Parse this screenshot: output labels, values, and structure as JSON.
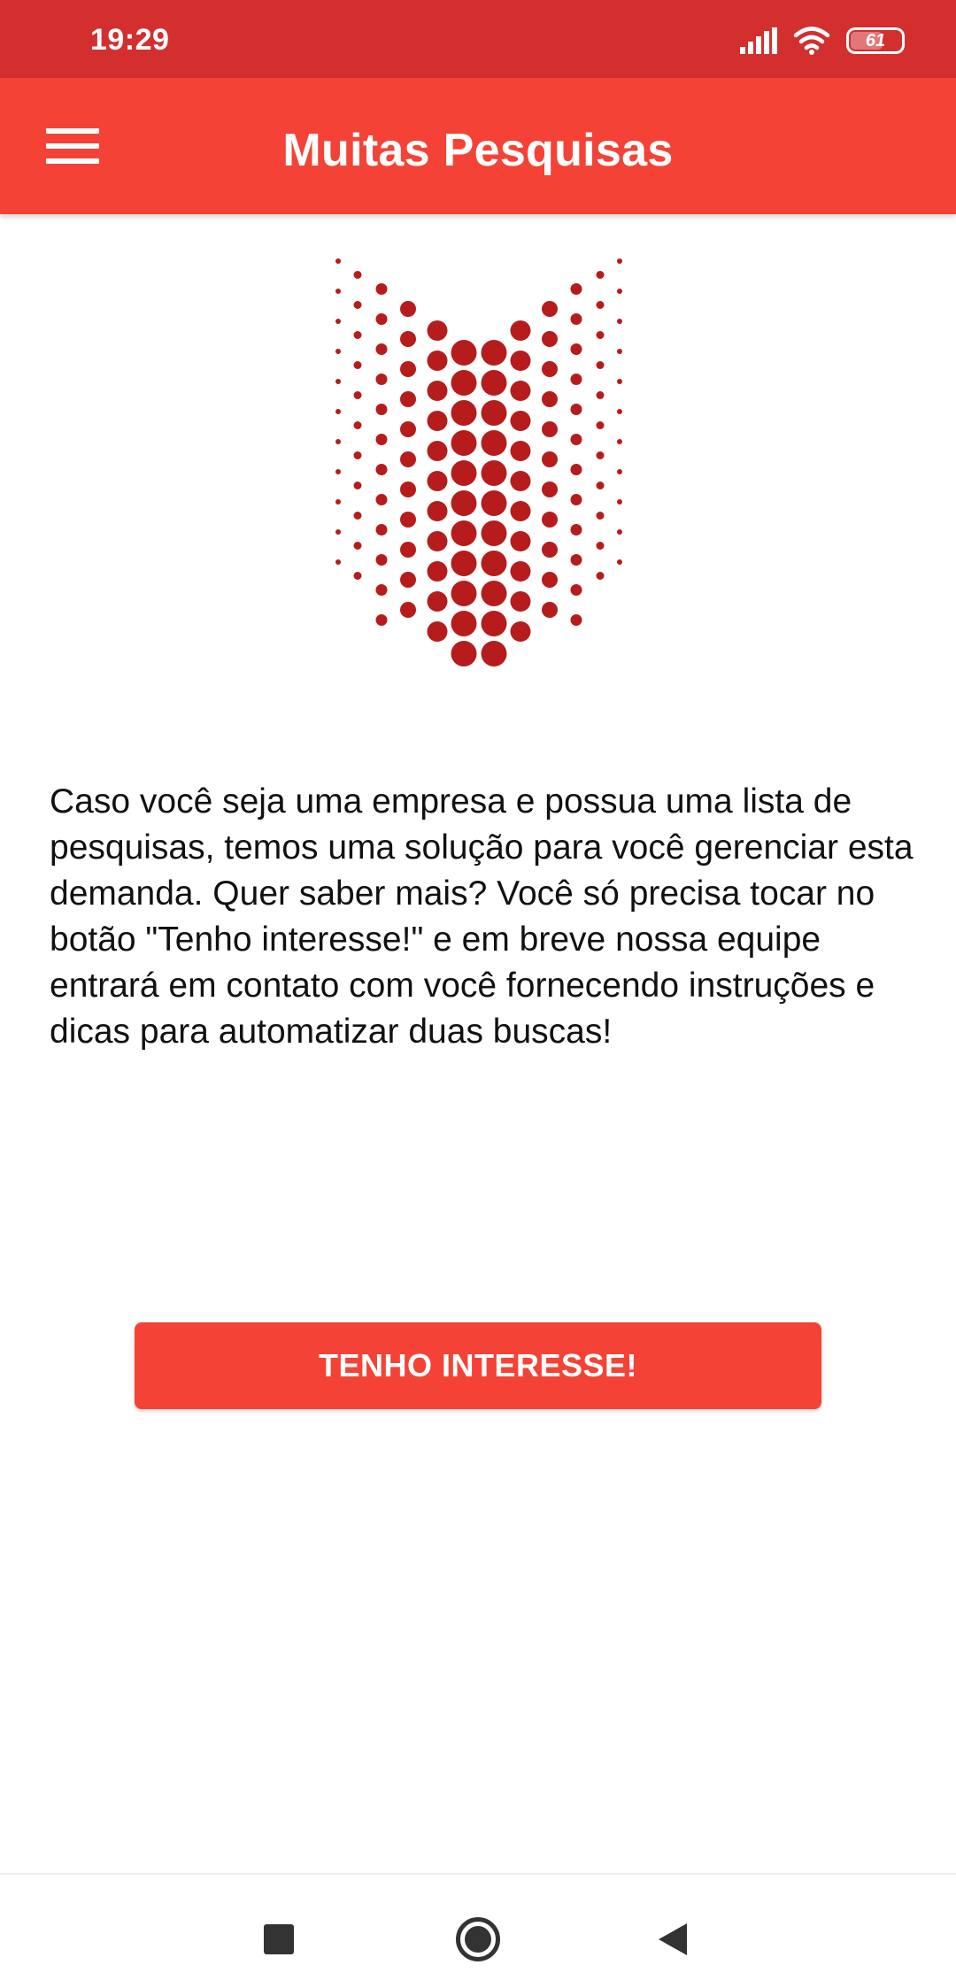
{
  "status_bar": {
    "time": "19:29",
    "battery_level": "61",
    "icons": [
      "signal-icon",
      "wifi-icon",
      "battery-icon"
    ]
  },
  "app_bar": {
    "title": "Muitas Pesquisas",
    "menu_icon": "hamburger-menu-icon"
  },
  "logo": {
    "icon": "dotted-chevron-logo",
    "color": "#b71c1c"
  },
  "main": {
    "description": "Caso você seja uma empresa e possua uma lista de pesquisas, temos uma solução para você gerenciar esta demanda. Quer saber mais? Você só precisa tocar no botão \"Tenho interesse!\" e em breve nossa equipe entrará em contato com você fornecendo instruções e dicas para automatizar duas buscas!",
    "button_label": "TENHO INTERESSE!"
  },
  "nav_bar": {
    "icons": [
      "recents-square-icon",
      "home-circle-icon",
      "back-triangle-icon"
    ]
  },
  "colors": {
    "status_bar": "#d32f2f",
    "app_bar": "#f44336",
    "button": "#f44336",
    "logo": "#b71c1c"
  }
}
